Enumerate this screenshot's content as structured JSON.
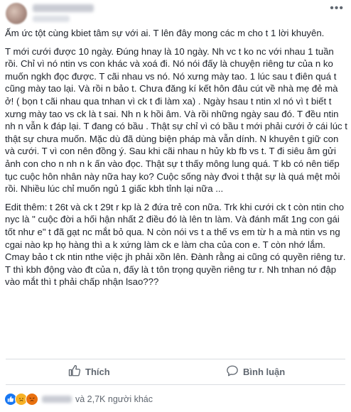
{
  "post": {
    "paragraphs": [
      "Ấm ức tột cùng kbiet tâm sự với ai. T lên đây mong các m cho t 1 lời khuyên.",
      "T mới cưới được 10 ngày. Đúng hnay là 10 ngày. Nh vc t ko nc với nhau 1 tuần rồi. Chỉ vì nó ntin vs con khác và xoá đi. Nó nói đấy là chuyện riêng tư của n ko muốn ngkh đọc được. T cãi nhau vs nó. Nó xưng mày tao. 1 lúc sau t điên quá t cũng mày tao lại. Và rồi n bảo t. Chưa đăng kí kết hôn đâu cút về nhà mẹ đẻ mà ở! ( bọn t cãi nhau qua tnhan vì ck t đi làm xa) . Ngày hsau t ntin xl nó vì t biết t xưng mày tao vs ck là t sai. Nh n k hồi âm. Và rồi những ngày sau đó. T đều ntin nh n vẫn k đáp lại. T đang có bầu . Thật sự chỉ vì có bầu t mới phải cưới ở cái lúc t thật sự chưa muốn. Mặc dù đã dùng biện pháp mà vẫn dính. N khuyên t giữ con và cưới. T vì con nên đồng ý. Sau khi cãi nhau n hủy kb fb vs t. T đi siêu âm gửi ảnh con cho n nh n k ấn vào đọc. Thật sự t thấy mông lung quá. T kb có nên tiếp tục cuộc hôn nhân này nữa hay ko? Cuộc sống này đvoi t thật sự là quá mệt mỏi rồi. Nhiều lúc chỉ muốn ngủ 1 giấc kbh tỉnh lại nữa ...",
      "Edit thêm: t 26t và ck t 29t r kp là 2 đứa trẻ con nữa. Trk khi cưới ck t còn ntin cho nyc là \" cuộc đời a hối hận nhất 2 điều đó là lên tn làm. Và đánh mất 1ng con gái tốt như e\" t đã gạt nc mắt bỏ qua. N còn nói vs t a thế vs em từ h a mà ntin vs ng cgai nào kp họ hàng thì a k xứng làm ck e làm cha của con e. T còn nhớ lắm. Cmay bảo t ck ntin nthe việc jh phải xồn lên. Đành rằng ai cũng có quyền riêng tư. T thì kbh động vào đt của n, đấy là t tôn trọng quyền riêng tư r. Nh tnhan nó đập vào mắt thì t phải chấp nhận lsao???"
    ]
  },
  "actions": {
    "like_label": "Thích",
    "comment_label": "Bình luận"
  },
  "reactions": {
    "types": [
      "like",
      "sad",
      "angry"
    ],
    "summary": "và 2,7K người khác"
  },
  "icons": {
    "more": "more-dots-icon",
    "like": "thumbs-up-icon",
    "comment": "comment-bubble-icon"
  },
  "colors": {
    "text": "#1d2129",
    "muted": "#606770",
    "like_blue": "#1877f2",
    "sad_yellow": "#f7b125",
    "angry_orange": "#e9710f",
    "divider": "#dadde1"
  }
}
